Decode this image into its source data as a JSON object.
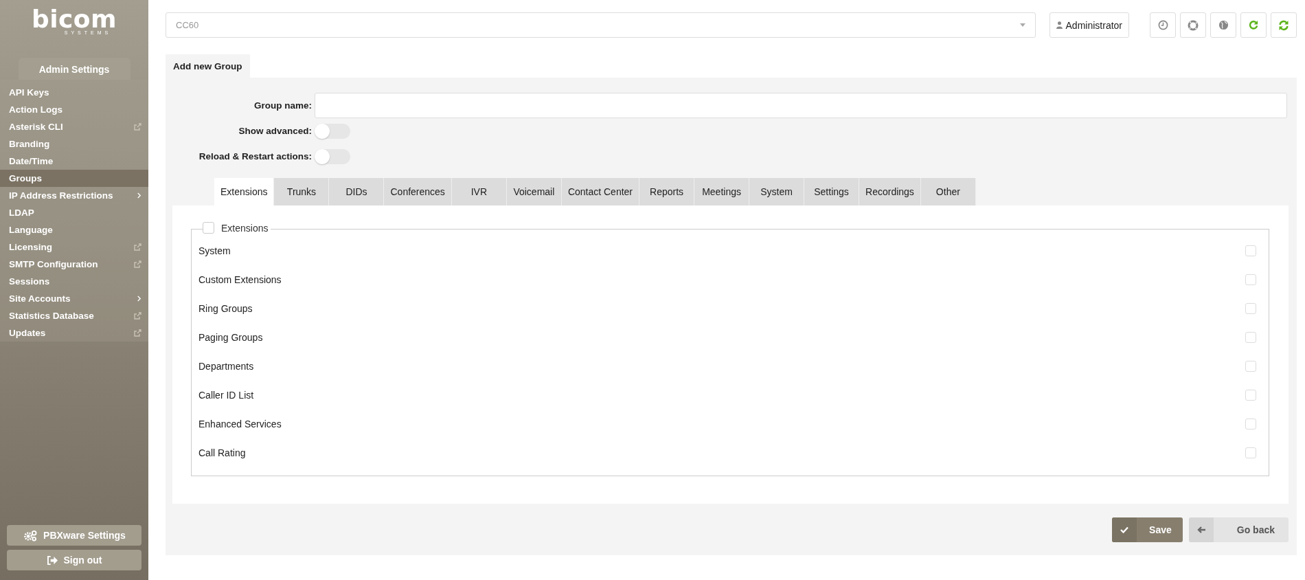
{
  "logo": {
    "name": "bicom",
    "tagline": "SYSTEMS"
  },
  "sidebar": {
    "section": "Admin Settings",
    "items": [
      {
        "label": "API Keys",
        "kind": "plain",
        "selected": false
      },
      {
        "label": "Action Logs",
        "kind": "plain",
        "selected": false
      },
      {
        "label": "Asterisk CLI",
        "kind": "external",
        "selected": false
      },
      {
        "label": "Branding",
        "kind": "plain",
        "selected": false
      },
      {
        "label": "Date/Time",
        "kind": "plain",
        "selected": false
      },
      {
        "label": "Groups",
        "kind": "plain",
        "selected": true
      },
      {
        "label": "IP Address Restrictions",
        "kind": "submenu",
        "selected": false
      },
      {
        "label": "LDAP",
        "kind": "plain",
        "selected": false
      },
      {
        "label": "Language",
        "kind": "plain",
        "selected": false
      },
      {
        "label": "Licensing",
        "kind": "external",
        "selected": false
      },
      {
        "label": "SMTP Configuration",
        "kind": "external",
        "selected": false
      },
      {
        "label": "Sessions",
        "kind": "plain",
        "selected": false
      },
      {
        "label": "Site Accounts",
        "kind": "submenu",
        "selected": false
      },
      {
        "label": "Statistics Database",
        "kind": "external",
        "selected": false
      },
      {
        "label": "Updates",
        "kind": "external",
        "selected": false
      }
    ],
    "bottom_buttons": [
      {
        "label": "PBXware Settings",
        "kind": "gears"
      },
      {
        "label": "Sign out",
        "kind": "signout"
      }
    ]
  },
  "top_bar": {
    "server_select": "CC60",
    "user": "Administrator",
    "tools": [
      {
        "kind": "clock"
      },
      {
        "kind": "lifebuoy"
      },
      {
        "kind": "globe"
      },
      {
        "kind": "reload"
      },
      {
        "kind": "sync"
      }
    ]
  },
  "page_tab": "Add new Group",
  "form": {
    "group_name": {
      "label": "Group name:"
    },
    "toggles": [
      {
        "label": "Show advanced:",
        "on": false
      },
      {
        "label": "Reload & Restart actions:",
        "on": false
      }
    ]
  },
  "tabs": [
    {
      "label": "Extensions",
      "selected": true
    },
    {
      "label": "Trunks",
      "selected": false
    },
    {
      "label": "DIDs",
      "selected": false
    },
    {
      "label": "Conferences",
      "selected": false
    },
    {
      "label": "IVR",
      "selected": false
    },
    {
      "label": "Voicemail",
      "selected": false
    },
    {
      "label": "Contact Center",
      "selected": false
    },
    {
      "label": "Reports",
      "selected": false
    },
    {
      "label": "Meetings",
      "selected": false
    },
    {
      "label": "System",
      "selected": false
    },
    {
      "label": "Settings",
      "selected": false
    },
    {
      "label": "Recordings",
      "selected": false
    },
    {
      "label": "Other",
      "selected": false
    }
  ],
  "permissions": {
    "title": "Extensions",
    "checked": false,
    "rows": [
      {
        "label": "System",
        "checked": false
      },
      {
        "label": "Custom Extensions",
        "checked": false
      },
      {
        "label": "Ring Groups",
        "checked": false
      },
      {
        "label": "Paging Groups",
        "checked": false
      },
      {
        "label": "Departments",
        "checked": false
      },
      {
        "label": "Caller ID List",
        "checked": false
      },
      {
        "label": "Enhanced Services",
        "checked": false
      },
      {
        "label": "Call Rating",
        "checked": false
      }
    ]
  },
  "actions": [
    {
      "label": "Save",
      "kind": "save"
    },
    {
      "label": "Go back",
      "kind": "back"
    }
  ]
}
